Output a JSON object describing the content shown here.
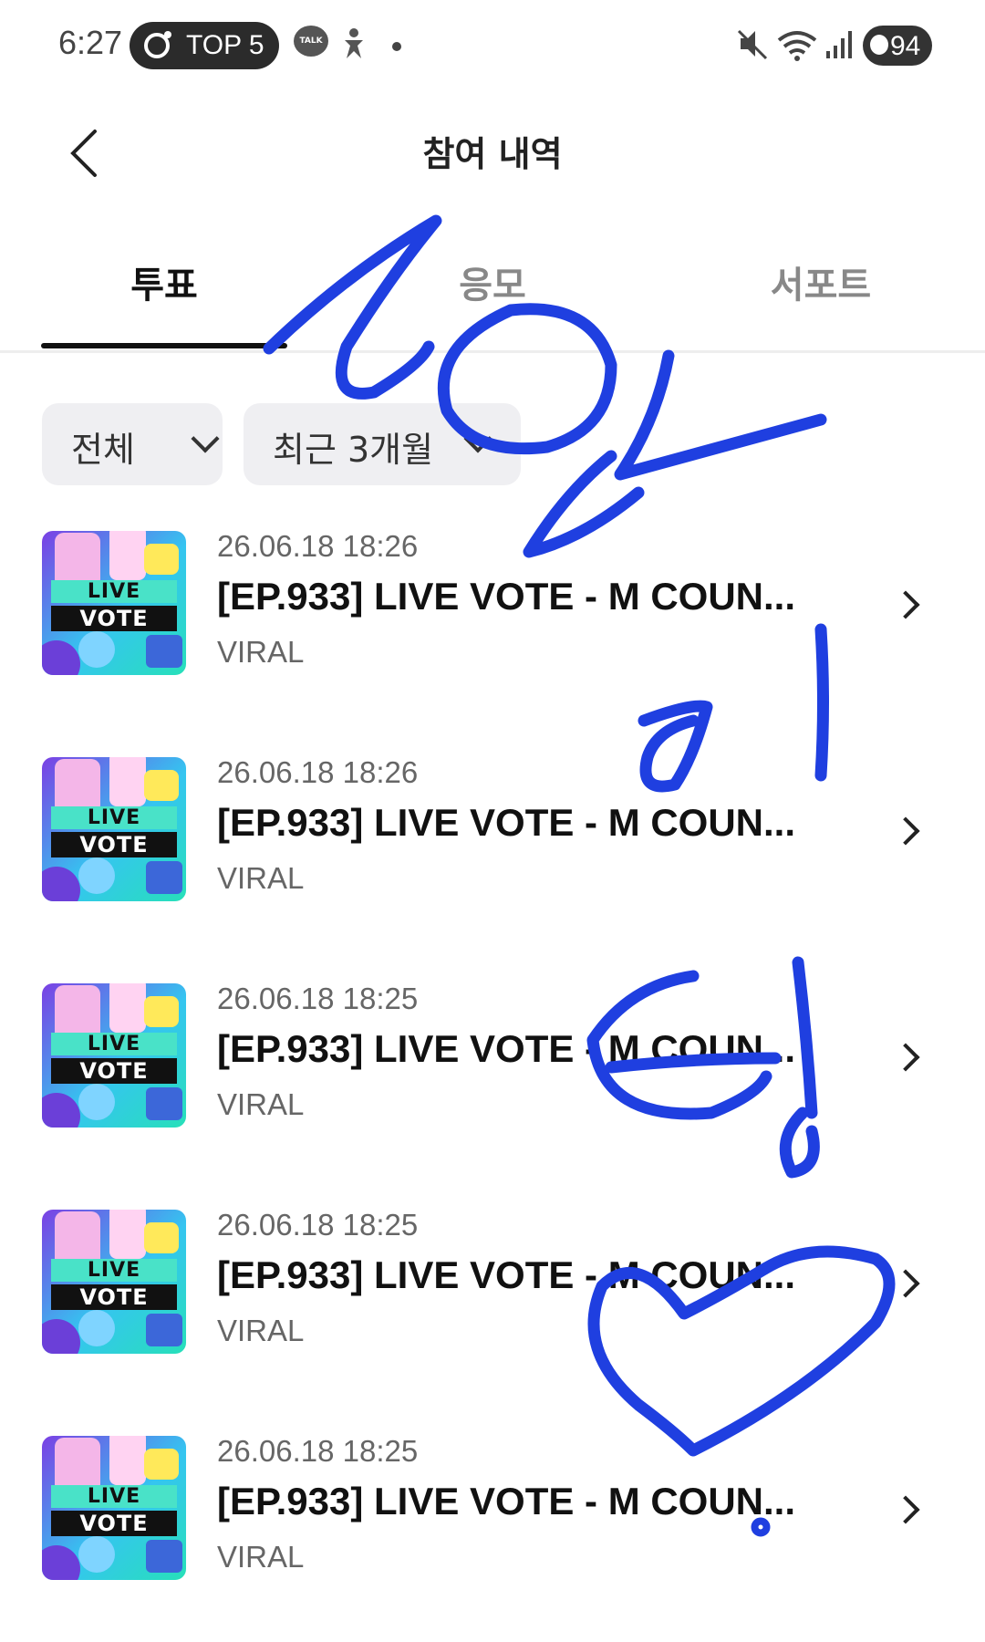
{
  "status_bar": {
    "time": "6:27",
    "pill_label": "TOP 5",
    "talk_label": "TALK",
    "battery": "94",
    "icons": [
      "notification-app-icon",
      "talk-icon",
      "accessibility-icon",
      "dot-icon",
      "mute-icon",
      "wifi-icon",
      "signal-icon",
      "battery-icon"
    ]
  },
  "header": {
    "title": "참여 내역",
    "back_icon": "chevron-left-icon"
  },
  "tabs": [
    {
      "label": "투표",
      "active": true
    },
    {
      "label": "응모",
      "active": false
    },
    {
      "label": "서포트",
      "active": false
    }
  ],
  "filters": {
    "type": "전체",
    "period": "최근 3개월"
  },
  "thumbnail": {
    "line1": "LIVE",
    "line2": "VOTE"
  },
  "items": [
    {
      "date": "26.06.18 18:26",
      "title": "[EP.933] LIVE VOTE - M COUN...",
      "category": "VIRAL"
    },
    {
      "date": "26.06.18 18:26",
      "title": "[EP.933] LIVE VOTE - M COUN...",
      "category": "VIRAL"
    },
    {
      "date": "26.06.18 18:25",
      "title": "[EP.933] LIVE VOTE - M COUN...",
      "category": "VIRAL"
    },
    {
      "date": "26.06.18 18:25",
      "title": "[EP.933] LIVE VOTE - M COUN...",
      "category": "VIRAL"
    },
    {
      "date": "26.06.18 18:25",
      "title": "[EP.933] LIVE VOTE - M COUN...",
      "category": "VIRAL"
    }
  ],
  "colors": {
    "ink": "#1f3fe0",
    "active_tab": "#111111",
    "filter_bg": "#efeff2"
  }
}
